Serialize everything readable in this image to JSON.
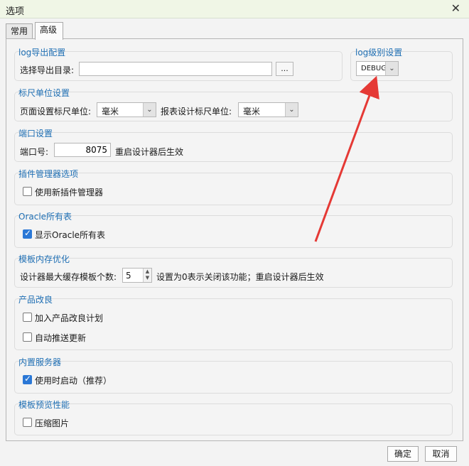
{
  "window": {
    "title": "选项"
  },
  "tabs": [
    {
      "label": "常用"
    },
    {
      "label": "高级"
    }
  ],
  "log_export": {
    "title": "log导出配置",
    "dir_label": "选择导出目录:",
    "dir_value": "",
    "browse_label": "..."
  },
  "log_level": {
    "title": "log级别设置",
    "value": "DEBUG"
  },
  "ruler": {
    "title": "标尺单位设置",
    "page_label": "页面设置标尺单位:",
    "page_value": "毫米",
    "report_label": "报表设计标尺单位:",
    "report_value": "毫米"
  },
  "port": {
    "title": "端口设置",
    "label": "端口号:",
    "value": "8075",
    "note": "重启设计器后生效"
  },
  "plugin": {
    "title": "插件管理器选项",
    "checkbox_label": "使用新插件管理器",
    "checked": false
  },
  "oracle": {
    "title": "Oracle所有表",
    "checkbox_label": "显示Oracle所有表",
    "checked": true
  },
  "template_cache": {
    "title": "模板内存优化",
    "label": "设计器最大缓存模板个数:",
    "value": "5",
    "note": "设置为0表示关闭该功能；重启设计器后生效"
  },
  "improve": {
    "title": "产品改良",
    "join_label": "加入产品改良计划",
    "join_checked": false,
    "push_label": "自动推送更新",
    "push_checked": false
  },
  "server": {
    "title": "内置服务器",
    "checkbox_label": "使用时启动（推荐）",
    "checked": true
  },
  "preview": {
    "title": "模板预览性能",
    "checkbox_label": "压缩图片",
    "checked": false
  },
  "buttons": {
    "ok": "确定",
    "cancel": "取消"
  },
  "colors": {
    "accent": "#1f6fb4",
    "annotation_arrow": "#e53935"
  }
}
